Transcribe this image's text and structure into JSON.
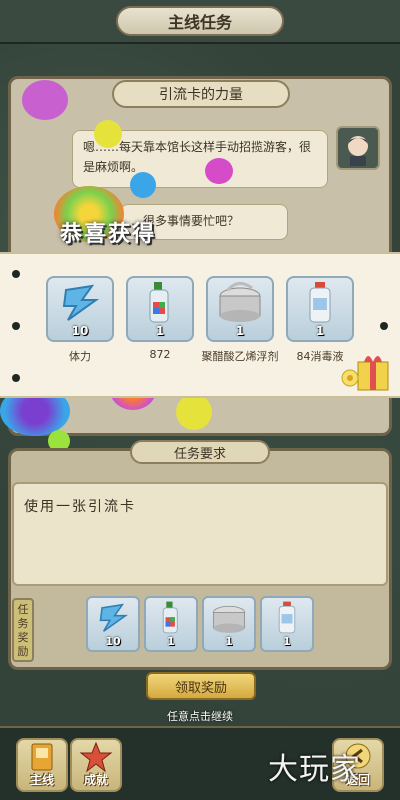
{
  "header": {
    "title": "主线任务"
  },
  "story": {
    "chapter_title": "引流卡的力量",
    "line_1": "嗯……每天靠本馆长这样手动招揽游客，很是麻烦啊。",
    "line_2": "…很多事情要忙吧？"
  },
  "popup": {
    "title": "恭喜获得",
    "items": [
      {
        "icon": "water-crystal-icon",
        "count": "10",
        "label": "体力"
      },
      {
        "icon": "soap-bottle-icon",
        "count": "1",
        "label": "872"
      },
      {
        "icon": "glue-can-icon",
        "count": "1",
        "label": "聚醋酸乙烯浮剂"
      },
      {
        "icon": "disinfectant-bottle-icon",
        "count": "1",
        "label": "84消毒液"
      }
    ],
    "hint": "任意点击继续"
  },
  "task": {
    "header": "任务要求",
    "requirement": "使用一张引流卡",
    "reward_label": "任务奖励",
    "rewards": [
      {
        "icon": "water-crystal-icon",
        "count": "10"
      },
      {
        "icon": "soap-bottle-icon",
        "count": "1"
      },
      {
        "icon": "glue-can-icon",
        "count": "1"
      },
      {
        "icon": "disinfectant-bottle-icon",
        "count": "1"
      }
    ],
    "claim_label": "领取奖励"
  },
  "nav": {
    "main_label": "主线",
    "achievement_label": "成就",
    "back_label": "返回"
  },
  "watermark": "大玩家",
  "colors": {
    "accent_gold": "#d5a940",
    "panel_tan": "#c9c0a9",
    "frame_green": "#34433a"
  }
}
